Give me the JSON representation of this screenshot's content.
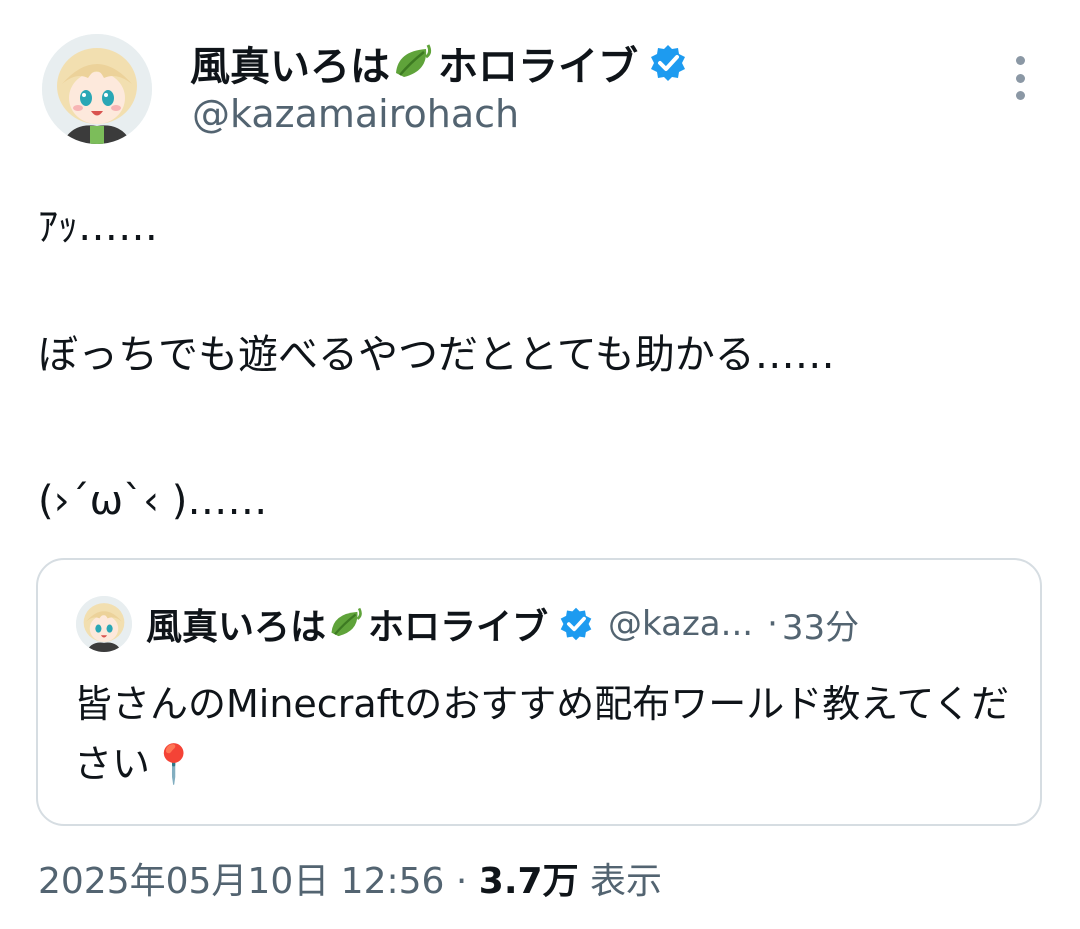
{
  "author": {
    "display_name": "風真いろは",
    "display_name_suffix": "ホロライブ",
    "handle": "@kazamairohach",
    "verified": true,
    "emoji_icon": "leaf-icon"
  },
  "tweet": {
    "lines": [
      "ｱｯ……",
      "ぼっちでも遊べるやつだととても助かる……",
      "(›´ω`‹ )……"
    ]
  },
  "quote": {
    "display_name": "風真いろは",
    "display_name_suffix": "ホロライブ",
    "handle": "@kaza...",
    "separator": "·",
    "time": "33分",
    "text": "皆さんのMinecraftのおすすめ配布ワールド教えてください📍"
  },
  "footer": {
    "date": "2025年05月10日 12:56",
    "separator": "·",
    "views_count": "3.7万",
    "views_label": "表示"
  },
  "colors": {
    "verified_blue": "#1d9bf0",
    "secondary_text": "#536471",
    "border": "#d6dde2",
    "leaf_green": "#5fa33a"
  }
}
